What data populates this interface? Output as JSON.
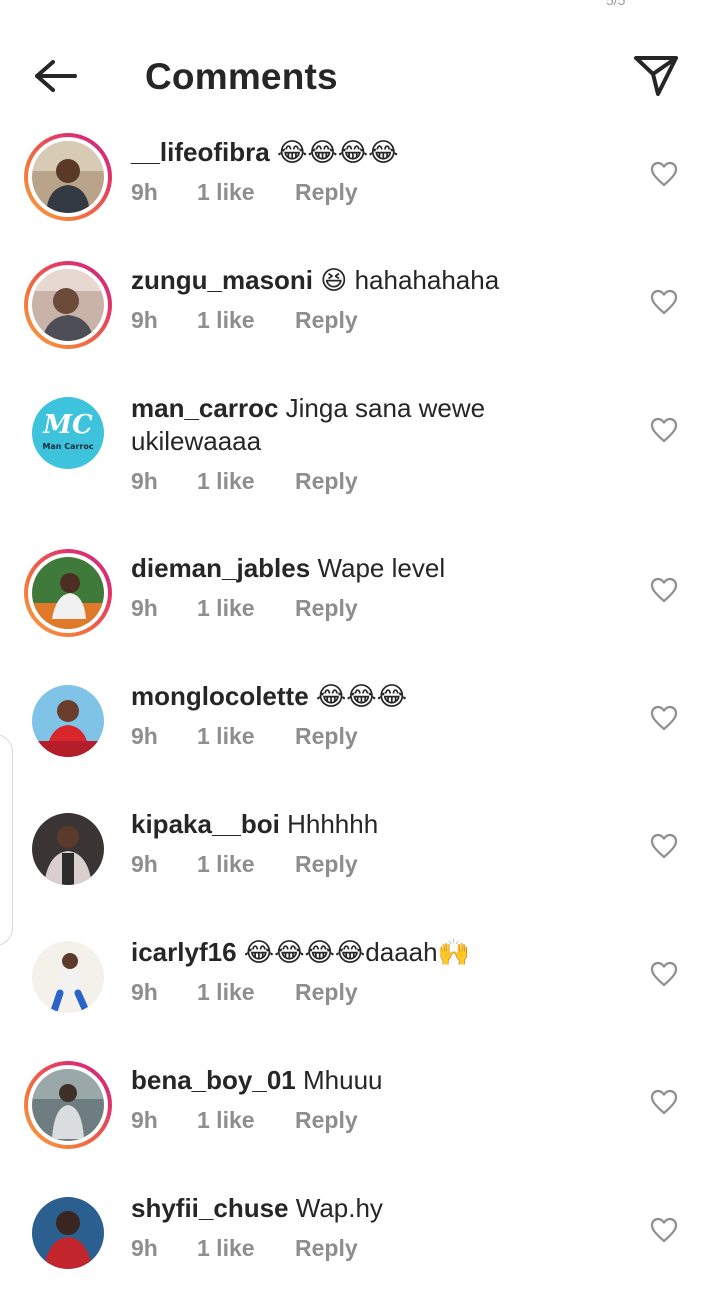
{
  "header": {
    "title": "Comments",
    "status_fragment": "5/5"
  },
  "icons": {
    "back": "arrow-left-icon",
    "share": "paper-plane-icon",
    "like": "heart-outline-icon"
  },
  "colors": {
    "text_primary": "#262626",
    "text_secondary": "#8e8e8e",
    "story_ring_start": "#f9a43a",
    "story_ring_end": "#c22f8c"
  },
  "comments": [
    {
      "username": "__lifeofibra",
      "text": "😂😂😂😂",
      "time": "9h",
      "likes": "1 like",
      "reply": "Reply",
      "has_story": true
    },
    {
      "username": "zungu_masoni",
      "text": "😆 hahahahaha",
      "time": "9h",
      "likes": "1 like",
      "reply": "Reply",
      "has_story": true
    },
    {
      "username": "man_carroc",
      "text": "Jinga sana wewe ukilewaaaa",
      "time": "9h",
      "likes": "1 like",
      "reply": "Reply",
      "has_story": false,
      "avatar_text": "Man Carroc"
    },
    {
      "username": "dieman_jables",
      "text": "Wape level",
      "time": "9h",
      "likes": "1 like",
      "reply": "Reply",
      "has_story": true
    },
    {
      "username": "monglocolette",
      "text": "😂😂😂",
      "time": "9h",
      "likes": "1 like",
      "reply": "Reply",
      "has_story": false
    },
    {
      "username": "kipaka__boi",
      "text": "Hhhhhh",
      "time": "9h",
      "likes": "1 like",
      "reply": "Reply",
      "has_story": false
    },
    {
      "username": "icarlyf16",
      "text": "😂😂😂😂daaah🙌",
      "time": "9h",
      "likes": "1 like",
      "reply": "Reply",
      "has_story": false
    },
    {
      "username": "bena_boy_01",
      "text": "Mhuuu",
      "time": "9h",
      "likes": "1 like",
      "reply": "Reply",
      "has_story": true
    },
    {
      "username": "shyfii_chuse",
      "text": "Wap.hy",
      "time": "9h",
      "likes": "1 like",
      "reply": "Reply",
      "has_story": false
    }
  ]
}
